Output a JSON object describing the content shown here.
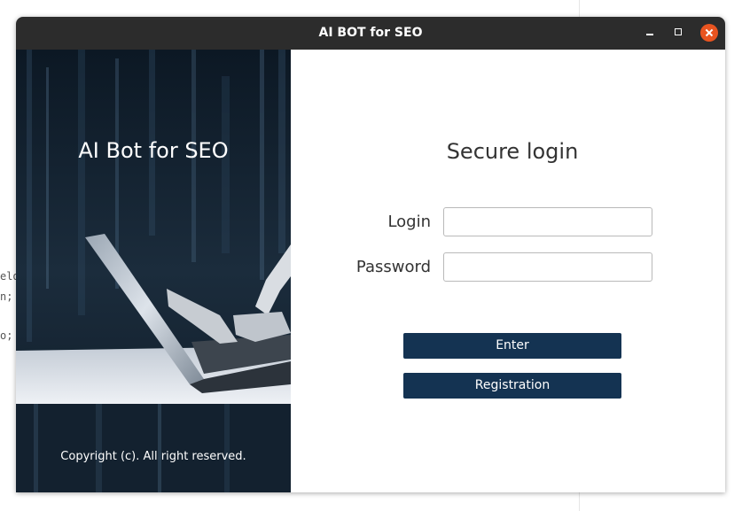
{
  "window": {
    "title": "AI BOT for SEO"
  },
  "background_code": {
    "lines": [
      "eld",
      "n;",
      "o;"
    ]
  },
  "left_panel": {
    "title": "AI Bot for SEO",
    "copyright": "Copyright (c). All right reserved.",
    "image": "laptop-robot-hands-image"
  },
  "login_form": {
    "heading": "Secure login",
    "login_label": "Login",
    "login_value": "",
    "password_label": "Password",
    "password_value": "",
    "enter_label": "Enter",
    "registration_label": "Registration"
  },
  "colors": {
    "titlebar": "#2c2c2c",
    "close_button": "#e95420",
    "button_bg": "#143352",
    "panel_dark": "#0f1b28"
  }
}
